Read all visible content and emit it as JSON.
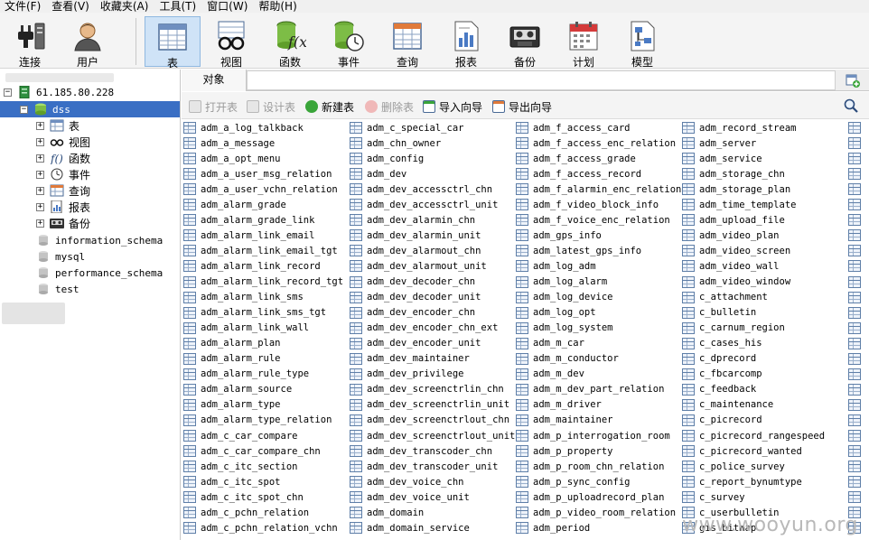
{
  "menu": [
    "文件(F)",
    "查看(V)",
    "收藏夹(A)",
    "工具(T)",
    "窗口(W)",
    "帮助(H)"
  ],
  "toolbar": [
    {
      "label": "连接",
      "icon": "connection-plug-icon"
    },
    {
      "label": "用户",
      "icon": "user-icon"
    },
    {
      "label": "表",
      "icon": "table-icon"
    },
    {
      "label": "视图",
      "icon": "view-glasses-icon"
    },
    {
      "label": "函数",
      "icon": "function-fx-icon"
    },
    {
      "label": "事件",
      "icon": "event-clock-icon"
    },
    {
      "label": "查询",
      "icon": "query-icon"
    },
    {
      "label": "报表",
      "icon": "report-icon"
    },
    {
      "label": "备份",
      "icon": "backup-tape-icon"
    },
    {
      "label": "计划",
      "icon": "schedule-calendar-icon"
    },
    {
      "label": "模型",
      "icon": "model-diagram-icon"
    }
  ],
  "tree": {
    "server": "61.185.80.228",
    "database": "dss",
    "db_children": [
      "表",
      "视图",
      "函数",
      "事件",
      "查询",
      "报表",
      "备份"
    ],
    "other_dbs": [
      "information_schema",
      "mysql",
      "performance_schema",
      "test"
    ]
  },
  "tabs": {
    "object": "对象"
  },
  "object_toolbar": {
    "open": "打开表",
    "design": "设计表",
    "new": "新建表",
    "delete": "删除表",
    "import": "导入向导",
    "export": "导出向导"
  },
  "tables": [
    [
      "adm_a_log_talkback",
      "adm_a_message",
      "adm_a_opt_menu",
      "adm_a_user_msg_relation",
      "adm_a_user_vchn_relation",
      "adm_alarm_grade",
      "adm_alarm_grade_link",
      "adm_alarm_link_email",
      "adm_alarm_link_email_tgt",
      "adm_alarm_link_record",
      "adm_alarm_link_record_tgt",
      "adm_alarm_link_sms",
      "adm_alarm_link_sms_tgt",
      "adm_alarm_link_wall",
      "adm_alarm_plan",
      "adm_alarm_rule",
      "adm_alarm_rule_type",
      "adm_alarm_source",
      "adm_alarm_type",
      "adm_alarm_type_relation",
      "adm_c_car_compare",
      "adm_c_car_compare_chn",
      "adm_c_itc_section",
      "adm_c_itc_spot",
      "adm_c_itc_spot_chn",
      "adm_c_pchn_relation",
      "adm_c_pchn_relation_vchn"
    ],
    [
      "adm_c_special_car",
      "adm_chn_owner",
      "adm_config",
      "adm_dev",
      "adm_dev_accessctrl_chn",
      "adm_dev_accessctrl_unit",
      "adm_dev_alarmin_chn",
      "adm_dev_alarmin_unit",
      "adm_dev_alarmout_chn",
      "adm_dev_alarmout_unit",
      "adm_dev_decoder_chn",
      "adm_dev_decoder_unit",
      "adm_dev_encoder_chn",
      "adm_dev_encoder_chn_ext",
      "adm_dev_encoder_unit",
      "adm_dev_maintainer",
      "adm_dev_privilege",
      "adm_dev_screenctrlin_chn",
      "adm_dev_screenctrlin_unit",
      "adm_dev_screenctrlout_chn",
      "adm_dev_screenctrlout_unit",
      "adm_dev_transcoder_chn",
      "adm_dev_transcoder_unit",
      "adm_dev_voice_chn",
      "adm_dev_voice_unit",
      "adm_domain",
      "adm_domain_service"
    ],
    [
      "adm_f_access_card",
      "adm_f_access_enc_relation",
      "adm_f_access_grade",
      "adm_f_access_record",
      "adm_f_alarmin_enc_relation",
      "adm_f_video_block_info",
      "adm_f_voice_enc_relation",
      "adm_gps_info",
      "adm_latest_gps_info",
      "adm_log_adm",
      "adm_log_alarm",
      "adm_log_device",
      "adm_log_opt",
      "adm_log_system",
      "adm_m_car",
      "adm_m_conductor",
      "adm_m_dev",
      "adm_m_dev_part_relation",
      "adm_m_driver",
      "adm_maintainer",
      "adm_p_interrogation_room",
      "adm_p_property",
      "adm_p_room_chn_relation",
      "adm_p_sync_config",
      "adm_p_uploadrecord_plan",
      "adm_p_video_room_relation",
      "adm_period"
    ],
    [
      "adm_record_stream",
      "adm_server",
      "adm_service",
      "adm_storage_chn",
      "adm_storage_plan",
      "adm_time_template",
      "adm_upload_file",
      "adm_video_plan",
      "adm_video_screen",
      "adm_video_wall",
      "adm_video_window",
      "c_attachment",
      "c_bulletin",
      "c_carnum_region",
      "c_cases_his",
      "c_dprecord",
      "c_fbcarcomp",
      "c_feedback",
      "c_maintenance",
      "c_picrecord",
      "c_picrecord_rangespeed",
      "c_picrecord_wanted",
      "c_police_survey",
      "c_report_bynumtype",
      "c_survey",
      "c_userbulletin",
      "gis_bitmap"
    ]
  ],
  "watermark": "www.wooyun.org"
}
